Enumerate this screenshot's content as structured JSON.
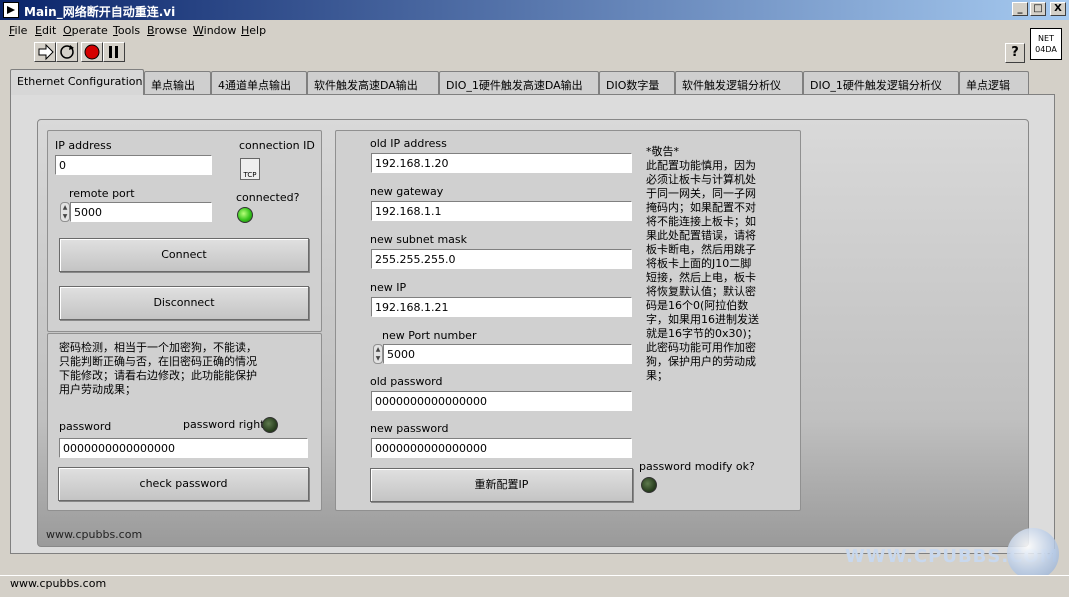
{
  "window": {
    "title": "Main_网络断开自动重连.vi",
    "minimize": "_",
    "maximize": "□",
    "close": "X"
  },
  "menu": [
    "File",
    "Edit",
    "Operate",
    "Tools",
    "Browse",
    "Window",
    "Help"
  ],
  "toolbar": {
    "help": "?",
    "vi_icon_line1": "NET",
    "vi_icon_line2": "04DA"
  },
  "tabs": [
    "Ethernet Configuration",
    "单点输出",
    "4通道单点输出",
    "软件触发高速DA输出",
    "DIO_1硬件触发高速DA输出",
    "DIO数字量",
    "软件触发逻辑分析仪",
    "DIO_1硬件触发逻辑分析仪",
    "单点逻辑"
  ],
  "connection": {
    "ip_label": "IP address",
    "ip_value": "0",
    "conn_id_label": "connection ID",
    "tcp_icon": "TCP",
    "remote_port_label": "remote port",
    "remote_port_value": "5000",
    "connected_label": "connected?",
    "connected": true,
    "connect_button": "Connect",
    "disconnect_button": "Disconnect"
  },
  "password": {
    "note": "密码检测，相当于一个加密狗，不能读，只能判断正确与否，在旧密码正确的情况下能修改；请看右边修改；此功能能保护用户劳动成果；",
    "password_label": "password",
    "password_value": "0000000000000000",
    "right_label": "password right?",
    "right": false,
    "check_button": "check password"
  },
  "config": {
    "old_ip_label": "old IP address",
    "old_ip_value": "192.168.1.20",
    "gateway_label": "new gateway",
    "gateway_value": "192.168.1.1",
    "subnet_label": "new subnet mask",
    "subnet_value": "255.255.255.0",
    "new_ip_label": "new IP",
    "new_ip_value": "192.168.1.21",
    "port_label": "new Port number",
    "port_value": "5000",
    "old_pw_label": "old password",
    "old_pw_value": "0000000000000000",
    "new_pw_label": "new password",
    "new_pw_value": "0000000000000000",
    "reconfig_button": "重新配置IP",
    "modify_label": "password modify ok?",
    "modify_ok": false,
    "warning": "*敬告*\n此配置功能慎用，因为必须让板卡与计算机处于同一网关，同一子网掩码内；如果配置不对将不能连接上板卡；如果此处配置错误，请将板卡断电，然后用跳子将板卡上面的J10二脚短接，然后上电，板卡将恢复默认值；默认密码是16个0(阿拉伯数字，如果用16进制发送就是16字节的0x30)；此密码功能可用作加密狗，保护用户的劳动成果；"
  },
  "footer": {
    "inner_url": "www.cpubbs.com",
    "status_url": "www.cpubbs.com",
    "watermark": "WWW.CPUBBS.COM"
  },
  "colors": {
    "titlebar_start": "#0a246a",
    "led_on": "#36c41c",
    "led_off": "#2c4222"
  }
}
